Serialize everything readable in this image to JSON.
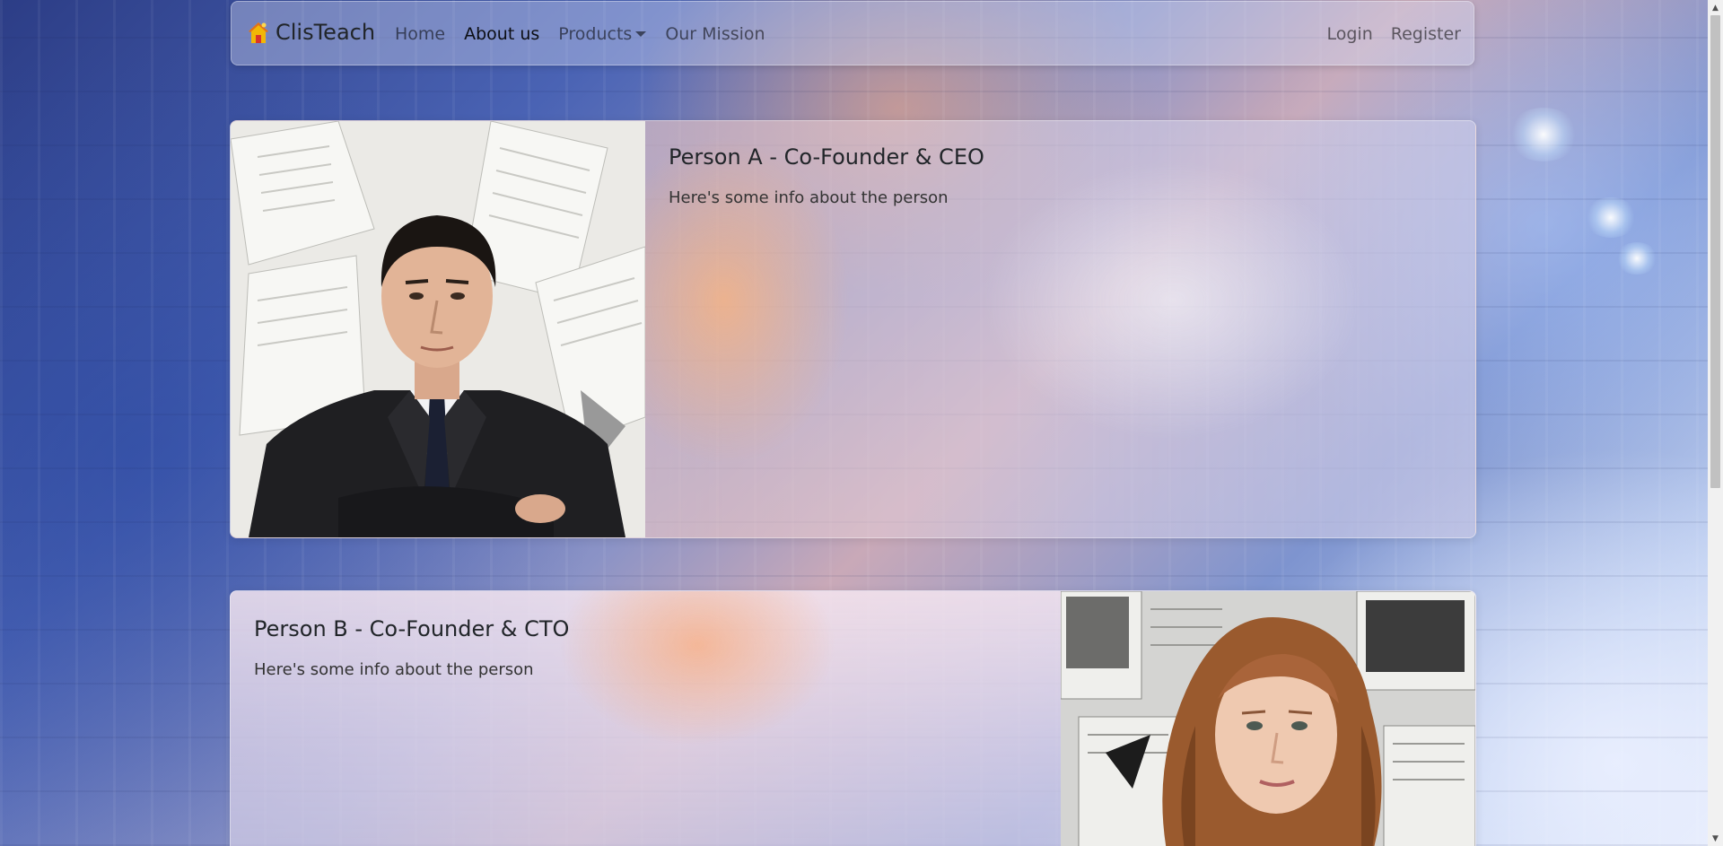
{
  "navbar": {
    "brand": "ClisTeach",
    "links": [
      {
        "label": "Home"
      },
      {
        "label": "About us"
      },
      {
        "label": "Products"
      },
      {
        "label": "Our Mission"
      }
    ],
    "right_links": [
      {
        "label": "Login"
      },
      {
        "label": "Register"
      }
    ]
  },
  "team": [
    {
      "title": "Person A - Co-Founder & CEO",
      "text": "Here's some info about the person"
    },
    {
      "title": "Person B - Co-Founder & CTO",
      "text": "Here's some info about the person"
    }
  ],
  "colors": {
    "nav_active": "#212529",
    "nav_muted": "#7a7c82"
  }
}
